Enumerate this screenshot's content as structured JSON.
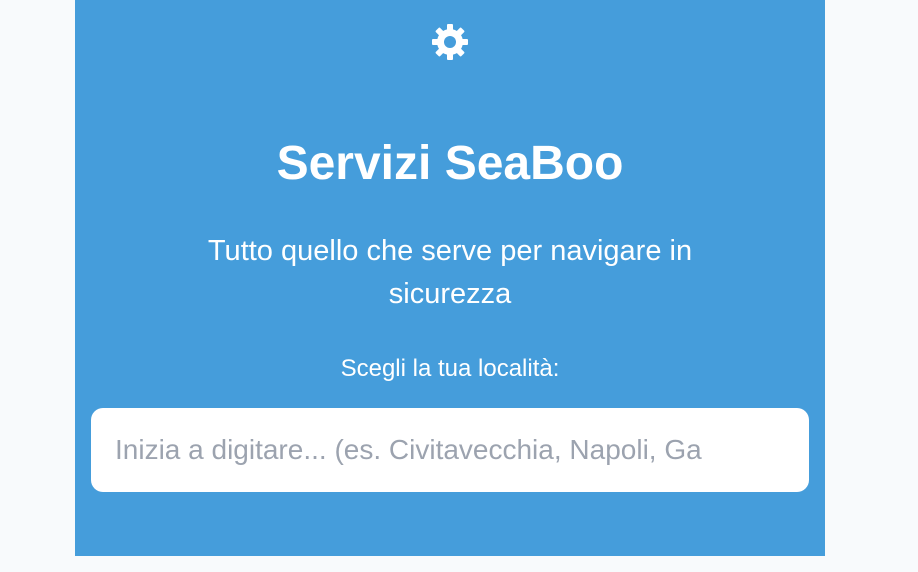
{
  "hero": {
    "icon": "gear-icon",
    "title": "Servizi SeaBoo",
    "subtitle": "Tutto quello che serve per navigare in sicurezza",
    "location_label": "Scegli la tua località:",
    "search": {
      "value": "",
      "placeholder": "Inizia a digitare... (es. Civitavecchia, Napoli, Ga"
    }
  },
  "colors": {
    "hero_background": "#459ddb",
    "page_background": "#f8fafc",
    "text": "#ffffff",
    "placeholder": "#9ca3af"
  }
}
